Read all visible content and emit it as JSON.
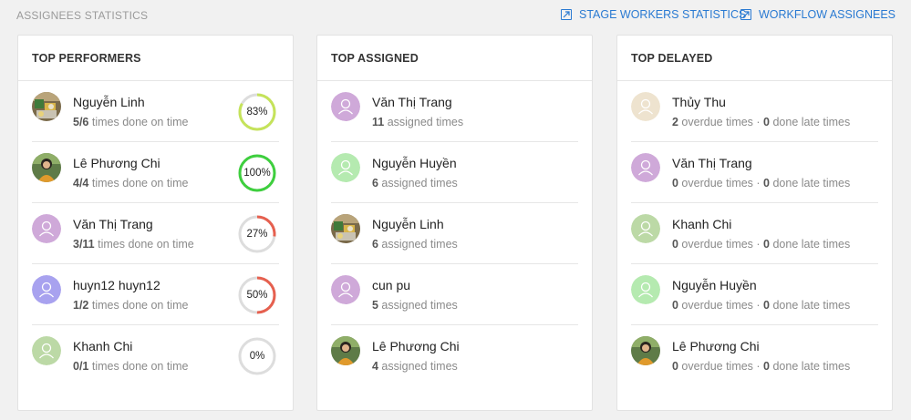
{
  "header": {
    "title": "ASSIGNEES STATISTICS",
    "links": [
      {
        "label": "STAGE WORKERS STATISTICS",
        "icon": "external-link-icon"
      },
      {
        "label": "WORKFLOW ASSIGNEES",
        "icon": "external-link-icon"
      }
    ]
  },
  "colors": {
    "link": "#2a7ad2",
    "ring_high": "#3ecf3e",
    "ring_mid": "#c5e35a",
    "ring_low": "#e6604f",
    "ring_track": "#dddddd"
  },
  "top_performers": {
    "title": "TOP PERFORMERS",
    "items": [
      {
        "name": "Nguyễn Linh",
        "done": "5/6",
        "suffix": " times done on time",
        "percent_label": "83%",
        "percent": 83,
        "avatar": "photo-food"
      },
      {
        "name": "Lê Phương Chi",
        "done": "4/4",
        "suffix": " times done on time",
        "percent_label": "100%",
        "percent": 100,
        "avatar": "photo-person"
      },
      {
        "name": "Văn Thị Trang",
        "done": "3/11",
        "suffix": " times done on time",
        "percent_label": "27%",
        "percent": 27,
        "avatar": "user-icon-purple"
      },
      {
        "name": "huyn12 huyn12",
        "done": "1/2",
        "suffix": " times done on time",
        "percent_label": "50%",
        "percent": 50,
        "avatar": "user-icon-blue"
      },
      {
        "name": "Khanh Chi",
        "done": "0/1",
        "suffix": " times done on time",
        "percent_label": "0%",
        "percent": 0,
        "avatar": "user-icon-green"
      }
    ]
  },
  "top_assigned": {
    "title": "TOP ASSIGNED",
    "items": [
      {
        "name": "Văn Thị Trang",
        "count": "11",
        "suffix": " assigned times",
        "avatar": "user-icon-purple"
      },
      {
        "name": "Nguyễn Huyền",
        "count": "6",
        "suffix": " assigned times",
        "avatar": "user-icon-lightgreen"
      },
      {
        "name": "Nguyễn Linh",
        "count": "6",
        "suffix": " assigned times",
        "avatar": "photo-food"
      },
      {
        "name": "cun pu",
        "count": "5",
        "suffix": " assigned times",
        "avatar": "user-icon-purple"
      },
      {
        "name": "Lê Phương Chi",
        "count": "4",
        "suffix": " assigned times",
        "avatar": "photo-person"
      }
    ]
  },
  "top_delayed": {
    "title": "TOP DELAYED",
    "items": [
      {
        "name": "Thủy Thu",
        "overdue": "2",
        "overdue_suffix": " overdue times · ",
        "late": "0",
        "late_suffix": " done late times",
        "avatar": "user-icon-beige"
      },
      {
        "name": "Văn Thị Trang",
        "overdue": "0",
        "overdue_suffix": " overdue times · ",
        "late": "0",
        "late_suffix": " done late times",
        "avatar": "user-icon-purple"
      },
      {
        "name": "Khanh Chi",
        "overdue": "0",
        "overdue_suffix": " overdue times · ",
        "late": "0",
        "late_suffix": " done late times",
        "avatar": "user-icon-green"
      },
      {
        "name": "Nguyễn Huyền",
        "overdue": "0",
        "overdue_suffix": " overdue times · ",
        "late": "0",
        "late_suffix": " done late times",
        "avatar": "user-icon-lightgreen"
      },
      {
        "name": "Lê Phương Chi",
        "overdue": "0",
        "overdue_suffix": " overdue times · ",
        "late": "0",
        "late_suffix": " done late times",
        "avatar": "photo-person"
      }
    ]
  }
}
